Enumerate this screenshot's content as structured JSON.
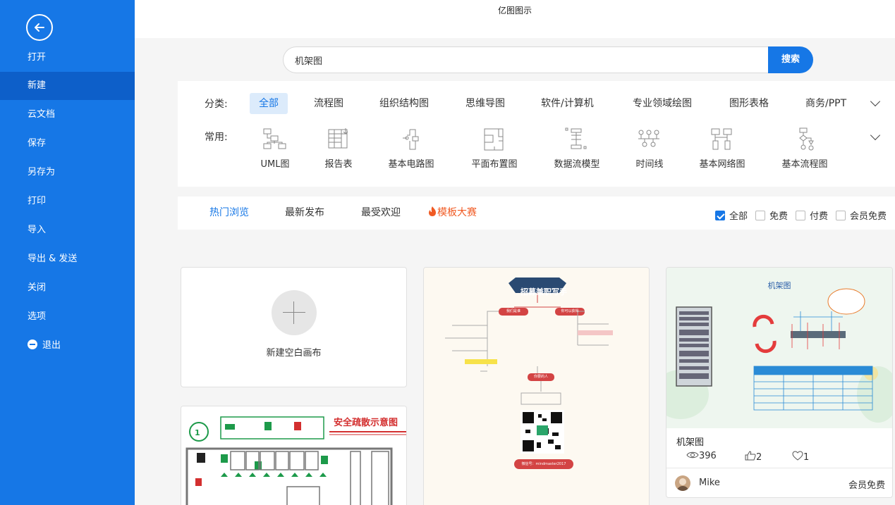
{
  "app_title": "亿图图示",
  "sidebar": {
    "items": [
      {
        "label": "打开"
      },
      {
        "label": "新建"
      },
      {
        "label": "云文档"
      },
      {
        "label": "保存"
      },
      {
        "label": "另存为"
      },
      {
        "label": "打印"
      },
      {
        "label": "导入"
      },
      {
        "label": "导出 & 发送"
      },
      {
        "label": "关闭"
      },
      {
        "label": "选项"
      },
      {
        "label": "退出"
      }
    ],
    "active": "新建",
    "bg_color": "#1677e6",
    "active_color": "#0d5fc9"
  },
  "search": {
    "value": "机架图",
    "button": "搜索"
  },
  "categories": {
    "label": "分类:",
    "items": [
      "全部",
      "流程图",
      "组织结构图",
      "思维导图",
      "软件/计算机",
      "专业领域绘图",
      "图形表格",
      "商务/PPT"
    ],
    "active": "全部"
  },
  "common": {
    "label": "常用:",
    "items": [
      "UML图",
      "报告表",
      "基本电路图",
      "平面布置图",
      "数据流模型",
      "时间线",
      "基本网络图",
      "基本流程图"
    ]
  },
  "tabs": {
    "items": [
      "热门浏览",
      "最新发布",
      "最受欢迎",
      "模板大赛"
    ],
    "active": "热门浏览"
  },
  "filters": {
    "items": [
      {
        "label": "全部",
        "checked": true
      },
      {
        "label": "免费",
        "checked": false
      },
      {
        "label": "付费",
        "checked": false
      },
      {
        "label": "会员免费",
        "checked": false
      }
    ]
  },
  "cards": {
    "new_canvas": "新建空白画布",
    "safety": {
      "title": "安全疏散示意图"
    },
    "mindmap": {
      "title": "招募兼职写手",
      "left_top": "我们是谁",
      "right_top": "你可以获得",
      "bottom": "你要的人",
      "footer": "微信号：mindmaster2017"
    },
    "rack": {
      "thumb_title": "机架图",
      "name": "机架图",
      "views": "396",
      "likes": "2",
      "favs": "1",
      "author": "Mike",
      "price": "会员免费"
    }
  }
}
